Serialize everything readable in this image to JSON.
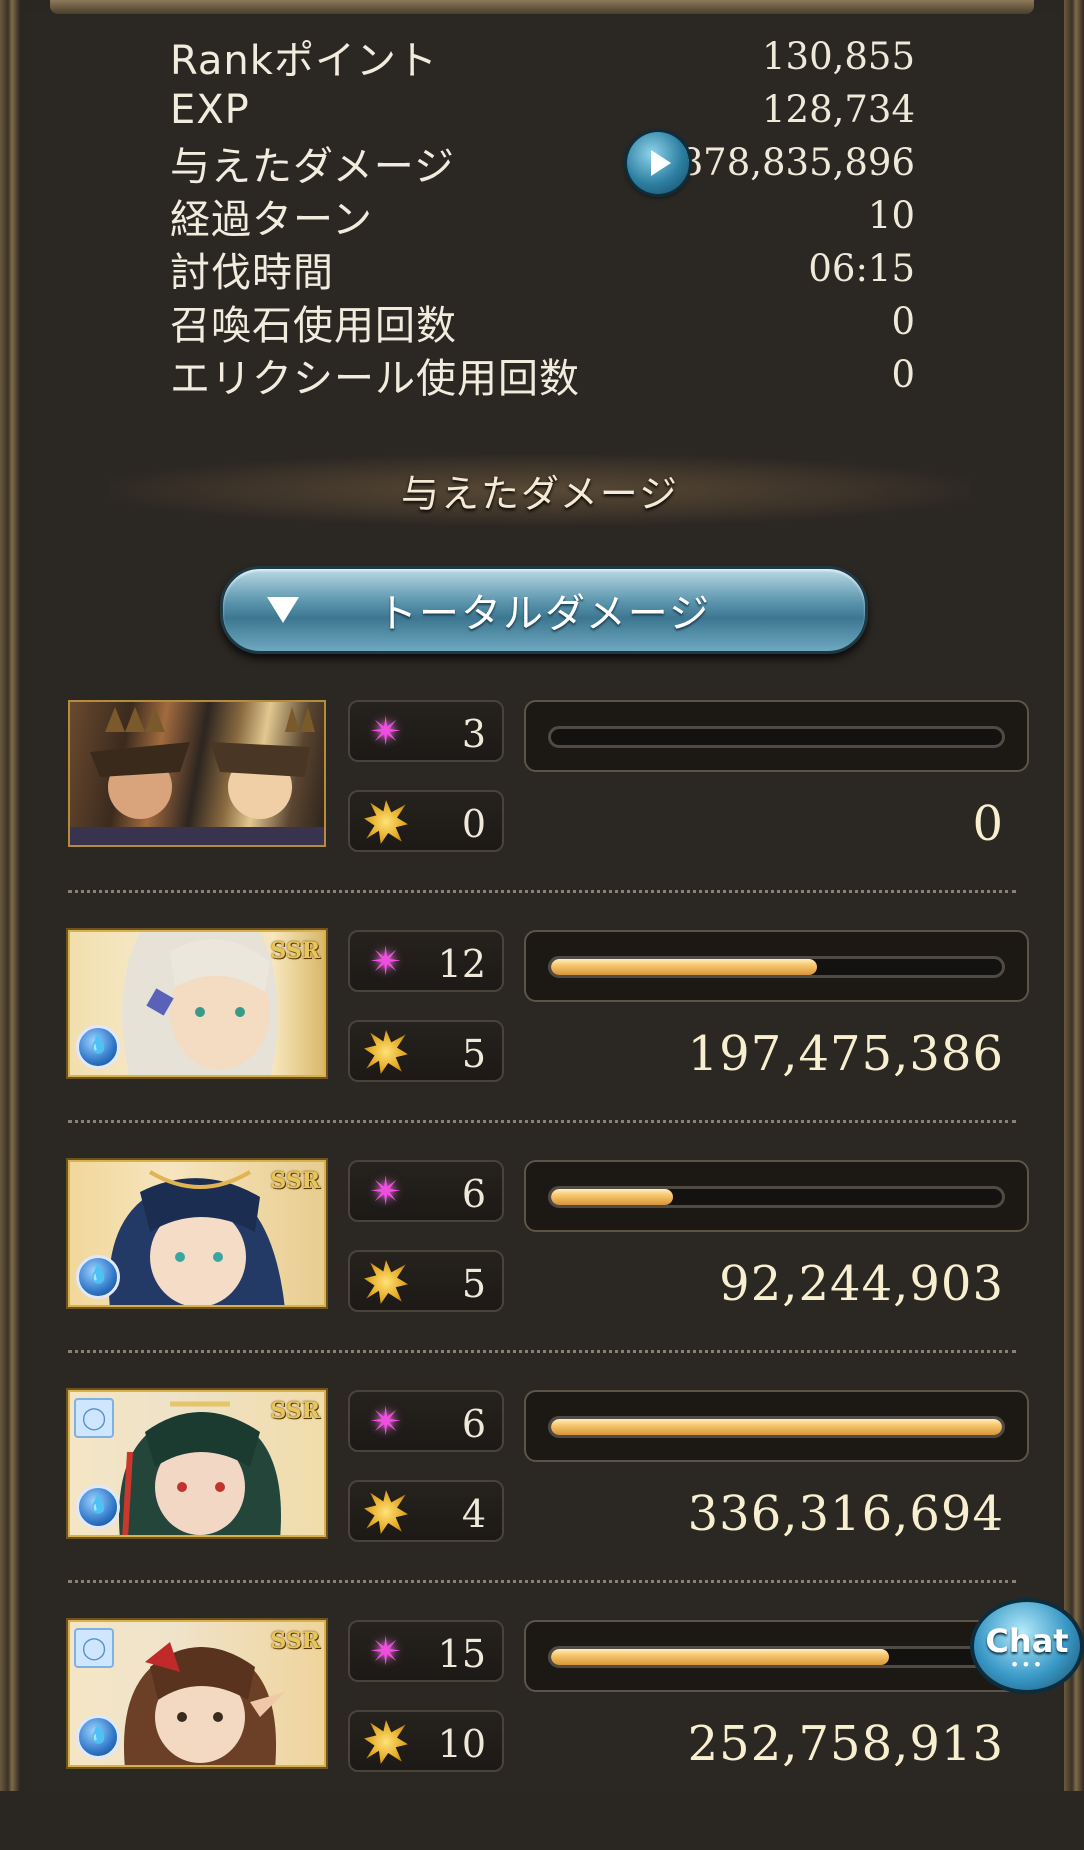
{
  "stats": [
    {
      "label": "Rankポイント",
      "value": "130,855"
    },
    {
      "label": "EXP",
      "value": "128,734"
    },
    {
      "label": "与えたダメージ",
      "value": "878,835,896"
    },
    {
      "label": "経過ターン",
      "value": "10"
    },
    {
      "label": "討伐時間",
      "value": "06:15"
    },
    {
      "label": "召喚石使用回数",
      "value": "0"
    },
    {
      "label": "エリクシール使用回数",
      "value": "0"
    }
  ],
  "section_title": "与えたダメージ",
  "dropdown": {
    "label": "トータルダメージ"
  },
  "characters": [
    {
      "skill_count": "3",
      "ougi_count": "0",
      "damage": "0",
      "bar_fraction": 0,
      "rarity": ""
    },
    {
      "skill_count": "12",
      "ougi_count": "5",
      "damage": "197,475,386",
      "bar_fraction": 0.59,
      "rarity": "SSR"
    },
    {
      "skill_count": "6",
      "ougi_count": "5",
      "damage": "92,244,903",
      "bar_fraction": 0.27,
      "rarity": "SSR"
    },
    {
      "skill_count": "6",
      "ougi_count": "4",
      "damage": "336,316,694",
      "bar_fraction": 1.0,
      "rarity": "SSR"
    },
    {
      "skill_count": "15",
      "ougi_count": "10",
      "damage": "252,758,913",
      "bar_fraction": 0.75,
      "rarity": "SSR"
    }
  ],
  "chat": {
    "label": "Chat",
    "dots": "•••"
  },
  "colors": {
    "bar_fill": "#f6c56c",
    "skill_star": "#f04ee0",
    "accent_blue": "#3c7690"
  }
}
